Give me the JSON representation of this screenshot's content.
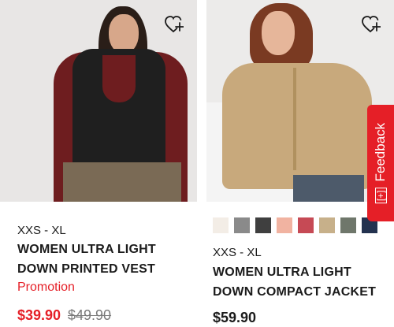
{
  "products": [
    {
      "size_range": "XXS - XL",
      "title_line1": "WOMEN ULTRA LIGHT",
      "title_line2": "DOWN PRINTED VEST",
      "promo_label": "Promotion",
      "sale_price": "$39.90",
      "original_price": "$49.90",
      "wishlist_icon": "heart-plus-icon"
    },
    {
      "size_range": "XXS - XL",
      "title_line1": "WOMEN ULTRA LIGHT",
      "title_line2": "DOWN COMPACT JACKET",
      "price": "$59.90",
      "wishlist_icon": "heart-plus-icon",
      "swatches": [
        {
          "color": "#f3ede6"
        },
        {
          "color": "#8a8a8a"
        },
        {
          "color": "#3f3f3f"
        },
        {
          "color": "#f1b3a1"
        },
        {
          "color": "#c64a55"
        },
        {
          "color": "#c7b08a"
        },
        {
          "color": "#6f776b"
        },
        {
          "color": "#23324f"
        }
      ]
    }
  ],
  "feedback": {
    "label": "Feedback",
    "icon": "[+]"
  },
  "colors": {
    "accent_red": "#e51f27",
    "text_dark": "#1b1b1b",
    "strike_gray": "#7a7a7a"
  }
}
